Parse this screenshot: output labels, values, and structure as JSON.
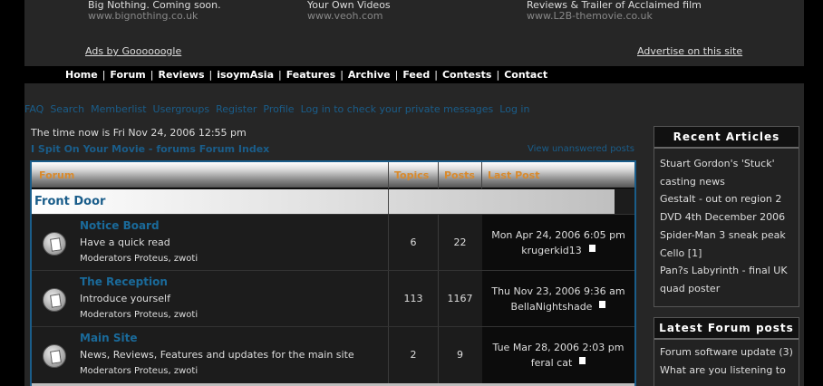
{
  "ads": [
    {
      "title": "Big Nothing. Coming soon.",
      "url": "www.bignothing.co.uk"
    },
    {
      "title": "Your Own Videos",
      "url": "www.veoh.com"
    },
    {
      "title": "Reviews & Trailer of Acclaimed film",
      "url": "www.L2B-themovie.co.uk"
    }
  ],
  "ads_by": "Ads by Goooooogle",
  "advertise": "Advertise on this site",
  "nav": [
    "Home",
    "Forum",
    "Reviews",
    "isoymAsia",
    "Features",
    "Archive",
    "Feed",
    "Contests",
    "Contact"
  ],
  "subnav": [
    "FAQ",
    "Search",
    "Memberlist",
    "Usergroups",
    "Register",
    "Profile",
    "Log in to check your private messages",
    "Log in"
  ],
  "time_now": "The time now is Fri Nov 24, 2006 12:55 pm",
  "forum_index": "I Spit On Your Movie - forums Forum Index",
  "view_unanswered": "View unanswered posts",
  "table_headers": {
    "forum": "Forum",
    "topics": "Topics",
    "posts": "Posts",
    "last_post": "Last Post"
  },
  "category": "Front Door",
  "forums": [
    {
      "name": "Notice Board",
      "desc": "Have a quick read",
      "mods": "Moderators Proteus, zwoti",
      "topics": "6",
      "posts": "22",
      "last_date": "Mon Apr 24, 2006 6:05 pm",
      "last_user": "krugerkid13"
    },
    {
      "name": "The Reception",
      "desc": "Introduce yourself",
      "mods": "Moderators Proteus, zwoti",
      "topics": "113",
      "posts": "1167",
      "last_date": "Thu Nov 23, 2006 9:36 am",
      "last_user": "BellaNightshade"
    },
    {
      "name": "Main Site",
      "desc": "News, Reviews, Features and updates for the main site",
      "mods": "Moderators Proteus, zwoti",
      "topics": "2",
      "posts": "9",
      "last_date": "Tue Mar 28, 2006 2:03 pm",
      "last_user": "feral cat"
    }
  ],
  "recent_articles": {
    "title": "Recent Articles",
    "items": [
      "Stuart Gordon's 'Stuck'",
      "casting news",
      "Gestalt - out on region 2",
      "DVD 4th December 2006",
      "Spider-Man 3 sneak peak",
      "Cello [1]",
      "Pan?s Labyrinth - final UK",
      "quad poster"
    ]
  },
  "latest_posts": {
    "title": "Latest Forum posts",
    "items": [
      "Forum software update (3)",
      "What are you listening to"
    ]
  },
  "colors": {
    "link": "#1a5d8a",
    "header_text": "#d98a2c",
    "background": "#262626"
  }
}
